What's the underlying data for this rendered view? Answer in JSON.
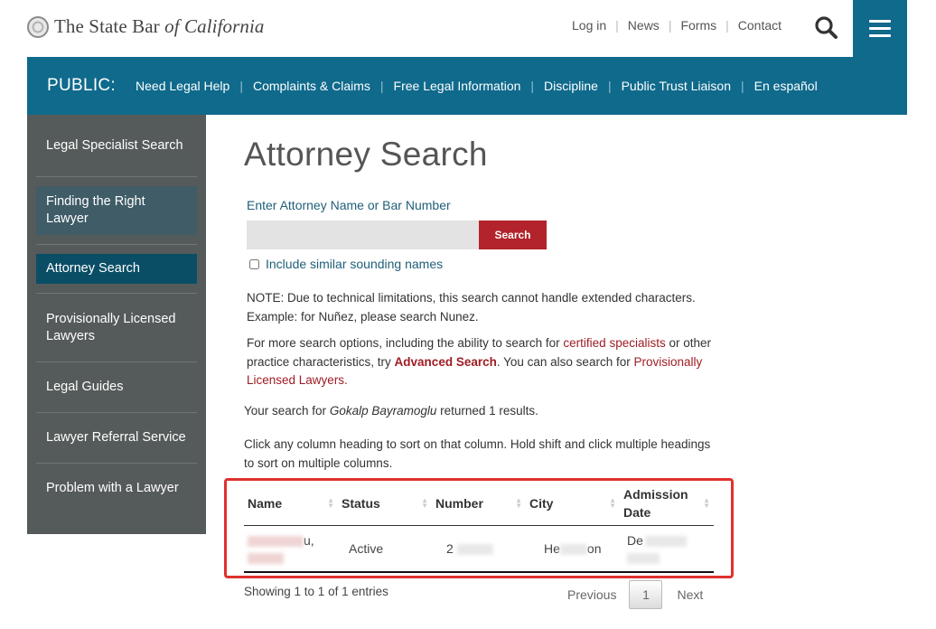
{
  "header": {
    "logo": {
      "pre": "The State Bar",
      "italic": "of California"
    },
    "utility_links": [
      "Log in",
      "News",
      "Forms",
      "Contact"
    ]
  },
  "public_nav": {
    "label": "PUBLIC:",
    "items": [
      "Need Legal Help",
      "Complaints & Claims",
      "Free Legal Information",
      "Discipline",
      "Public Trust Liaison",
      "En español"
    ]
  },
  "sidebar": {
    "items": [
      {
        "label": "Legal Specialist Search"
      },
      {
        "label": "Finding the Right Lawyer"
      },
      {
        "label": "Attorney Search"
      },
      {
        "label": "Provisionally Licensed Lawyers"
      },
      {
        "label": "Legal Guides"
      },
      {
        "label": "Lawyer Referral Service"
      },
      {
        "label": "Problem with a Lawyer"
      }
    ]
  },
  "main": {
    "title": "Attorney Search",
    "search_label": "Enter Attorney Name or Bar Number",
    "search_value": "",
    "search_button": "Search",
    "similar_label": "Include similar sounding names",
    "note1": "NOTE: Due to technical limitations, this search cannot handle extended characters.",
    "note2": "Example: for Nuñez, please search Nunez.",
    "more_a": "For more search options, including the ability to search for ",
    "more_link1": "certified specialists",
    "more_b": " or other practice characteristics, try ",
    "more_link2": "Advanced Search",
    "more_c": ". You can also search for ",
    "more_link3": "Provisionally Licensed Lawyers.",
    "result_a": "Your search for ",
    "result_query": "Gokalp Bayramoglu",
    "result_b": " returned 1 results.",
    "sort_hint": "Click any column heading to sort on that column. Hold shift and click multiple headings to sort on multiple columns."
  },
  "table": {
    "columns": [
      "Name",
      "Status",
      "Number",
      "City",
      "Admission Date"
    ],
    "rows": [
      {
        "name_visible": "u,",
        "status": "Active",
        "number_visible": "2",
        "city_pre": "He",
        "city_post": "on",
        "date_visible": "De"
      }
    ]
  },
  "pagination": {
    "info": "Showing 1 to 1 of 1 entries",
    "previous": "Previous",
    "page": "1",
    "next": "Next"
  },
  "colors": {
    "brand_blue": "#0f6a8c",
    "accent_red": "#b2232b",
    "highlight": "#e0312e",
    "sidebar": "#555b5a"
  }
}
